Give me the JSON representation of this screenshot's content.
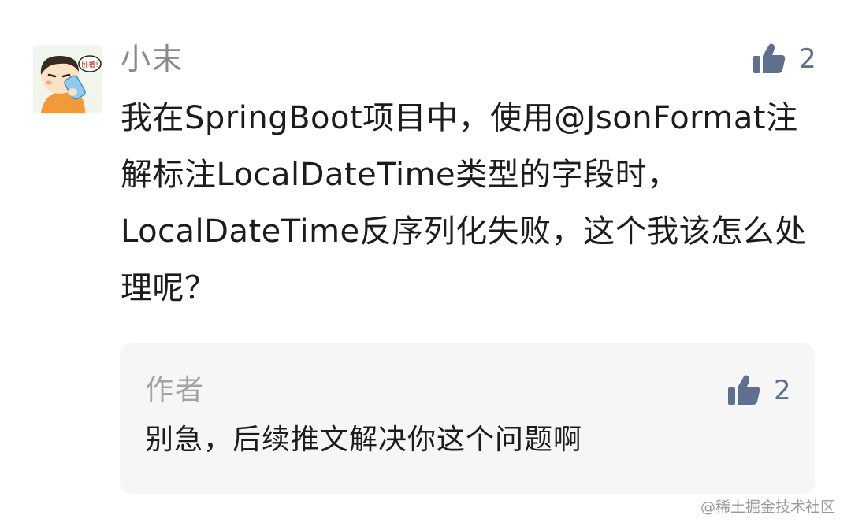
{
  "comment": {
    "username": "小末",
    "avatar_bubble_text": "卧槽!",
    "text": "我在SpringBoot项目中，使用@JsonFormat注解标注LocalDateTime类型的字段时，LocalDateTime反序列化失败，这个我该怎么处理呢？",
    "likes": "2",
    "like_icon": "thumbs-up-icon"
  },
  "reply": {
    "author_label": "作者",
    "text": "别急，后续推文解决你这个问题啊",
    "likes": "2",
    "like_icon": "thumbs-up-icon"
  },
  "watermark": {
    "text": "@稀土掘金技术社区"
  },
  "colors": {
    "like_icon": "#5f6f8e",
    "reply_background": "#f6f6f6",
    "username": "#8a8a8a"
  }
}
